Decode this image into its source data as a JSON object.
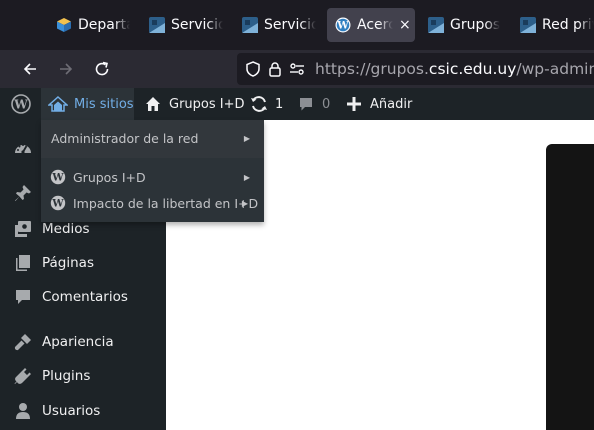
{
  "browser": {
    "tabs": [
      {
        "title": "Departa",
        "favicon": "departamento-favicon"
      },
      {
        "title": "Servicio",
        "favicon": "servicio-favicon"
      },
      {
        "title": "Servicio",
        "favicon": "servicio-favicon"
      },
      {
        "title": "Acerc",
        "favicon": "wordpress-icon",
        "active": true,
        "close": "×"
      },
      {
        "title": "Grupos",
        "favicon": "grupos-favicon"
      },
      {
        "title": "Red priv",
        "favicon": "red-favicon"
      }
    ],
    "url": {
      "prefix": "https://grupos.",
      "domain": "csic.edu.uy",
      "path": "/wp-admin/al"
    }
  },
  "admin_bar": {
    "my_sites": "Mis sitios",
    "site_name": "Grupos I+D",
    "updates_count": "1",
    "comments_count": "0",
    "add_new": "Añadir"
  },
  "my_sites_menu": {
    "network_admin": "Administrador de la red",
    "sites": [
      "Grupos I+D",
      "Impacto de la libertad en I+D"
    ],
    "arrow": "▶"
  },
  "side_menu": {
    "items": [
      {
        "label": "Medios",
        "icon": "media-icon"
      },
      {
        "label": "Páginas",
        "icon": "pages-icon"
      },
      {
        "label": "Comentarios",
        "icon": "comments-icon"
      },
      {
        "label": "Apariencia",
        "icon": "appearance-icon"
      },
      {
        "label": "Plugins",
        "icon": "plugins-icon"
      },
      {
        "label": "Usuarios",
        "icon": "users-icon"
      }
    ],
    "hidden_icons": [
      "dashboard-icon",
      "pin-icon"
    ]
  },
  "colors": {
    "wp_admin_bar": "#1d2327",
    "wp_hover_blue": "#72aee6",
    "browser_bg": "#1c1b22"
  }
}
